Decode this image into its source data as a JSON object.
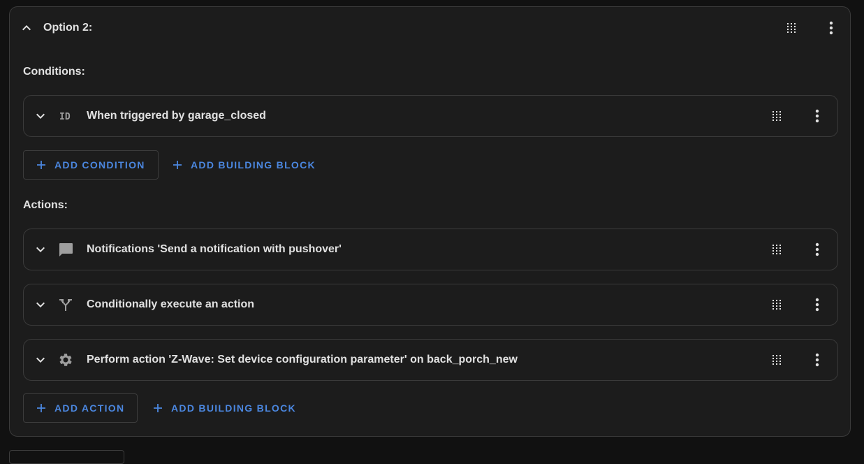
{
  "option": {
    "title": "Option 2:",
    "icons": {
      "collapse": "chevron-up-icon",
      "drag": "drag-handle-icon",
      "menu": "more-vertical-icon"
    }
  },
  "conditions": {
    "label": "Conditions:",
    "items": [
      {
        "label": "When triggered by garage_closed",
        "icon": "id-icon"
      }
    ],
    "add_condition_label": "ADD CONDITION",
    "add_building_block_label": "ADD BUILDING BLOCK"
  },
  "actions": {
    "label": "Actions:",
    "items": [
      {
        "label": "Notifications 'Send a notification with pushover'",
        "icon": "message-icon"
      },
      {
        "label": "Conditionally execute an action",
        "icon": "call-split-icon"
      },
      {
        "label": "Perform action 'Z-Wave: Set device configuration parameter' on back_porch_new",
        "icon": "gear-icon"
      }
    ],
    "add_action_label": "ADD ACTION",
    "add_building_block_label": "ADD BUILDING BLOCK"
  },
  "colors": {
    "background": "#1c1c1c",
    "border": "#3a3a3a",
    "accent": "#4b87e0",
    "text": "#e1e1e1",
    "icon": "#9e9e9e"
  }
}
